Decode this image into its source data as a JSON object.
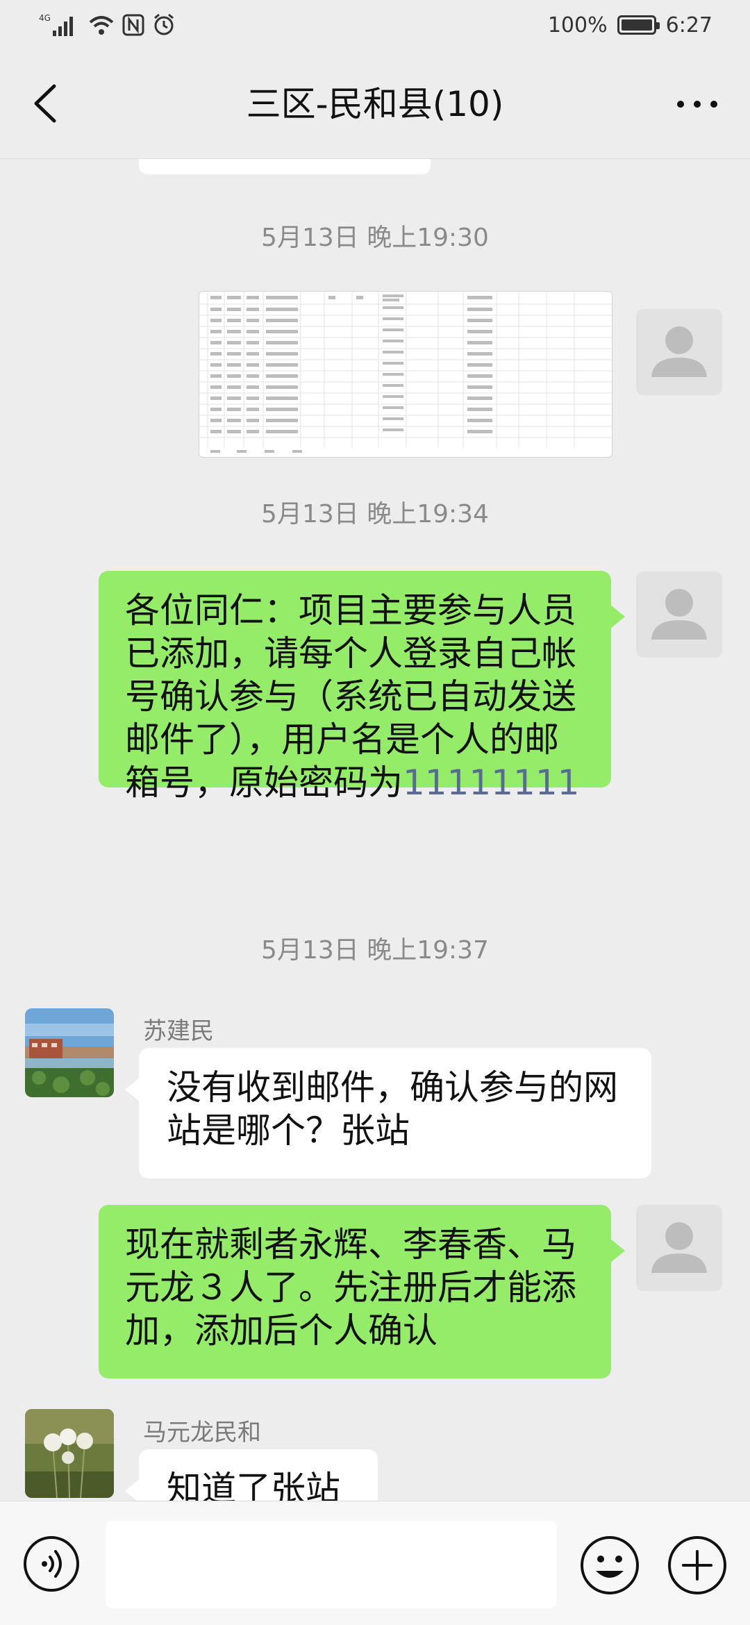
{
  "status_bar": {
    "network": "4G",
    "battery": "100%",
    "time": "6:27"
  },
  "header": {
    "title": "三区-民和县(10)"
  },
  "messages": {
    "time1": "5月13日 晚上19:30",
    "time2": "5月13日 晚上19:34",
    "msg2_text": "各位同仁：项目主要参与人员已添加，请每个人登录自己帐号确认参与（系统已自动发送邮件了），用户名是个人的邮箱号，原始密码为",
    "msg2_number": "11111111",
    "time3": "5月13日 晚上19:37",
    "msg3_sender": "苏建民",
    "msg3_text": "没有收到邮件，确认参与的网站是哪个？张站",
    "msg4_text": "现在就剩者永辉、李春香、马元龙３人了。先注册后才能添加，添加后个人确认",
    "msg5_sender": "马元龙民和",
    "msg5_text": "知道了张站"
  },
  "colors": {
    "own_bubble": "#95ec69",
    "other_bubble": "#ffffff",
    "chat_background": "#ededed",
    "link_number": "#576b95"
  },
  "icons": {
    "back": "chevron-left-icon",
    "more": "more-dots-icon",
    "voice": "voice-icon",
    "emoji": "emoji-icon",
    "plus": "plus-icon"
  }
}
